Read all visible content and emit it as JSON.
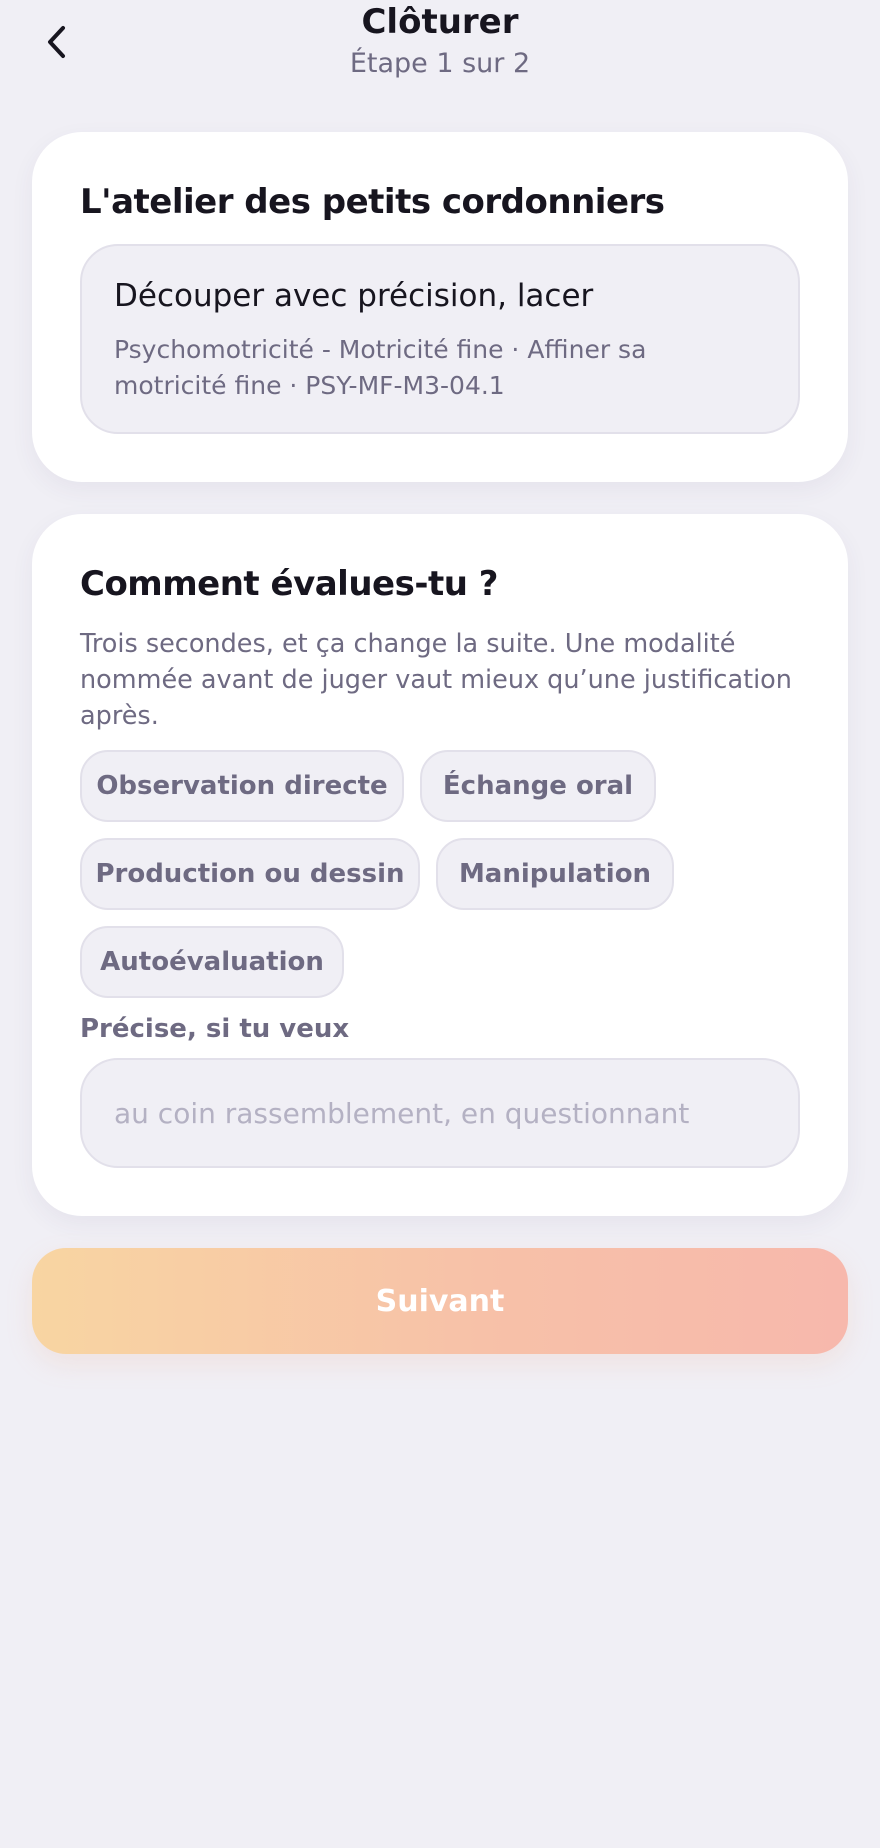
{
  "header": {
    "title": "Clôturer",
    "step": "Étape 1 sur 2",
    "back_icon": "chevron-left-icon"
  },
  "activity_card": {
    "title": "L'atelier des petits cordonniers",
    "skill": {
      "name": "Découper avec précision, lacer",
      "meta": "Psychomotricité - Motricité fine · Affiner sa motricité fine · PSY-MF-M3-04.1"
    }
  },
  "evaluation_card": {
    "title": "Comment évalues-tu ?",
    "description": "Trois secondes, et ça change la suite. Une modalité nommée avant de juger vaut mieux qu’une justification après.",
    "options": [
      "Observation directe",
      "Échange oral",
      "Production ou dessin",
      "Manipulation",
      "Autoévaluation"
    ],
    "field_label": "Précise, si tu veux",
    "field_placeholder": "au coin rassemblement, en questionnant",
    "field_value": ""
  },
  "footer": {
    "next_label": "Suivant"
  },
  "colors": {
    "background": "#F0EFF5",
    "card": "#FFFFFF",
    "text_primary": "#17151F",
    "text_secondary": "#6E6A82",
    "placeholder": "#B4B1C3",
    "button_gradient_start": "#F8D5A2",
    "button_gradient_end": "#F7B8AC"
  }
}
